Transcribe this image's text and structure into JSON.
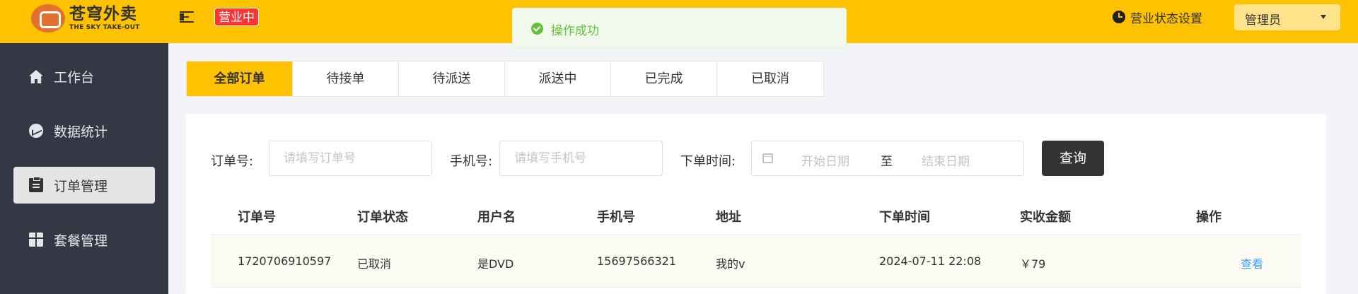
{
  "header": {
    "logo_cn": "苍穹外卖",
    "logo_en": "THE SKY TAKE-OUT",
    "status_tag": "营业中",
    "toast": "操作成功",
    "business_settings": "营业状态设置",
    "admin": "管理员",
    "colors": {
      "bar": "#ffc200",
      "tag": "#fd3333",
      "toast_text": "#67c23a"
    }
  },
  "sidebar": {
    "items": [
      {
        "label": "工作台",
        "icon": "home-icon"
      },
      {
        "label": "数据统计",
        "icon": "stats-icon"
      },
      {
        "label": "订单管理",
        "icon": "order-icon",
        "active": true
      },
      {
        "label": "套餐管理",
        "icon": "gift-icon"
      }
    ]
  },
  "tabs": [
    "全部订单",
    "待接单",
    "待派送",
    "派送中",
    "已完成",
    "已取消"
  ],
  "filters": {
    "order_no_label": "订单号:",
    "order_no_placeholder": "请填写订单号",
    "phone_label": "手机号:",
    "phone_placeholder": "请填写手机号",
    "time_label": "下单时间:",
    "start_placeholder": "开始日期",
    "range_sep": "至",
    "end_placeholder": "结束日期",
    "query_button": "查询"
  },
  "table": {
    "columns": [
      "订单号",
      "订单状态",
      "用户名",
      "手机号",
      "地址",
      "下单时间",
      "实收金额",
      "操作"
    ],
    "rows": [
      {
        "order_no": "1720706910597",
        "status": "已取消",
        "username": "是DVD",
        "phone": "15697566321",
        "address": "我的v",
        "time": "2024-07-11 22:08",
        "amount": "￥79",
        "action": "查看"
      }
    ]
  }
}
